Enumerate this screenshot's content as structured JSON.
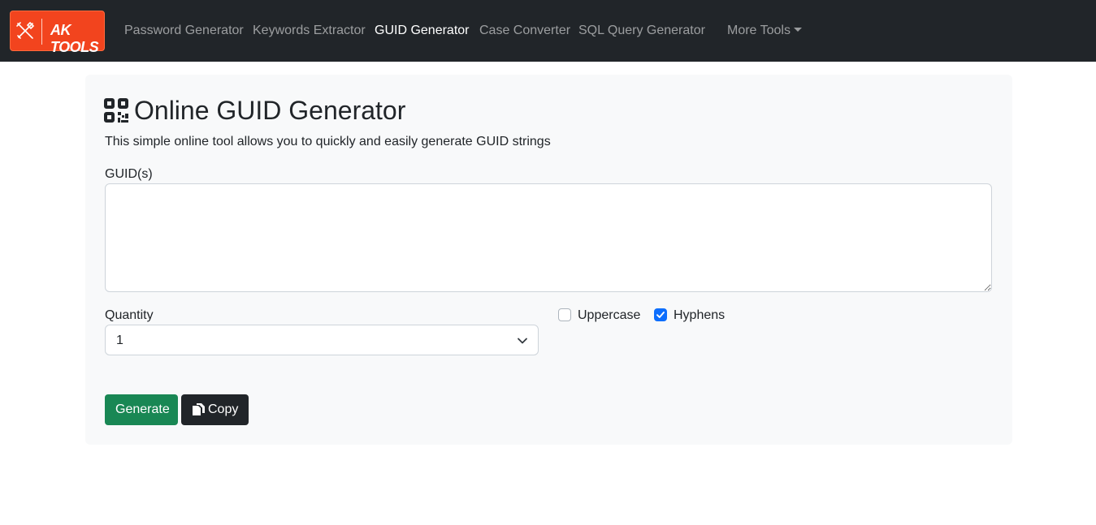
{
  "brand": {
    "text": "AK TOOLS",
    "color": "#f2441e",
    "icon": "tools-icon"
  },
  "nav": {
    "items": [
      {
        "label": "Password Generator",
        "active": false
      },
      {
        "label": "Keywords Extractor",
        "active": false
      },
      {
        "label": "GUID Generator",
        "active": true
      },
      {
        "label": "Case Converter",
        "active": false
      },
      {
        "label": "SQL Query Generator",
        "active": false
      }
    ],
    "more": {
      "label": "More Tools",
      "icon": "caret-down-icon"
    }
  },
  "page": {
    "icon": "qr-code-icon",
    "title": "Online GUID Generator",
    "description": "This simple online tool allows you to quickly and easily generate GUID strings"
  },
  "form": {
    "guid_label": "GUID(s)",
    "guid_value": "",
    "quantity_label": "Quantity",
    "quantity_value": "1",
    "uppercase": {
      "label": "Uppercase",
      "checked": false
    },
    "hyphens": {
      "label": "Hyphens",
      "checked": true
    }
  },
  "buttons": {
    "generate": {
      "label": "Generate",
      "color": "#198754"
    },
    "copy": {
      "label": "Copy",
      "icon": "copy-icon",
      "color": "#212529"
    }
  },
  "colors": {
    "navbar": "#212529",
    "card": "#f8f9fa",
    "checkbox_accent": "#0d6efd"
  }
}
